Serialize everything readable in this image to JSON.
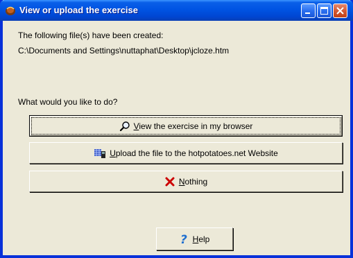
{
  "window": {
    "title": "View or upload the exercise",
    "colors": {
      "titlebar": "#0054e3",
      "face": "#ece9d8",
      "close": "#d45a35"
    }
  },
  "message": {
    "line1": "The following file(s) have been created:",
    "line2": "C:\\Documents and Settings\\nuttaphat\\Desktop\\jcloze.htm",
    "prompt": "What would you like to do?"
  },
  "buttons": {
    "view": {
      "mnemonic": "V",
      "rest": "iew the exercise in my browser",
      "icon": "magnifier-icon"
    },
    "upload": {
      "mnemonic": "U",
      "rest": "pload the file to the hotpotatoes.net Website",
      "icon": "upload-globe-icon"
    },
    "nothing": {
      "mnemonic": "N",
      "rest": "othing",
      "icon": "red-x-icon"
    },
    "help": {
      "mnemonic": "H",
      "rest": "elp",
      "icon": "question-mark-icon"
    }
  }
}
